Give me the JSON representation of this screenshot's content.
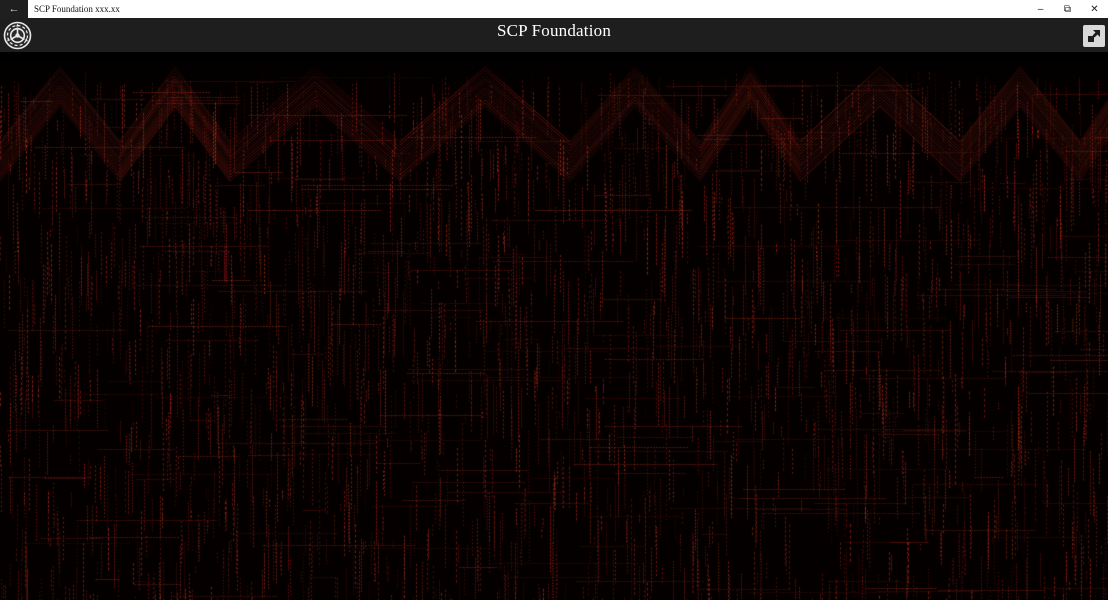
{
  "window": {
    "title": "SCP Foundation xxx.xx",
    "back_icon": "back-arrow-icon",
    "controls": {
      "minimize_glyph": "–",
      "restore_glyph": "⧉",
      "close_glyph": "✕"
    }
  },
  "header": {
    "title": "SCP Foundation",
    "logo_icon": "scp-logo-icon",
    "action_icon": "compact-overlay-icon",
    "background": "#1e1e1e"
  },
  "content": {
    "background": "#050000",
    "glitch_color": "#c0392b"
  }
}
